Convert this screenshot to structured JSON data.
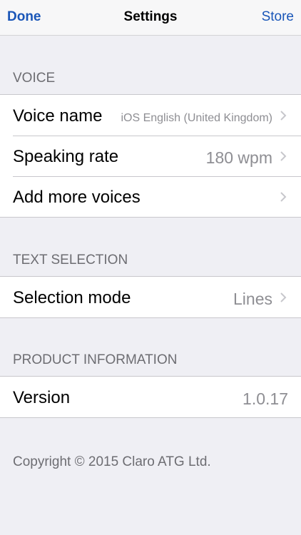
{
  "navbar": {
    "left_label": "Done",
    "title": "Settings",
    "right_label": "Store",
    "accent_color": "#1a56b8"
  },
  "sections": {
    "voice": {
      "header": "VOICE",
      "rows": [
        {
          "label": "Voice name",
          "value": "iOS English (United Kingdom)"
        },
        {
          "label": "Speaking rate",
          "value": "180 wpm"
        },
        {
          "label": "Add more voices",
          "value": ""
        }
      ]
    },
    "text_selection": {
      "header": "TEXT SELECTION",
      "rows": [
        {
          "label": "Selection mode",
          "value": "Lines"
        }
      ]
    },
    "product_information": {
      "header": "PRODUCT INFORMATION",
      "rows": [
        {
          "label": "Version",
          "value": "1.0.17"
        }
      ]
    }
  },
  "footer": {
    "copyright": "Copyright © 2015 Claro ATG Ltd."
  },
  "icons": {
    "disclosure": "chevron-right-icon"
  }
}
